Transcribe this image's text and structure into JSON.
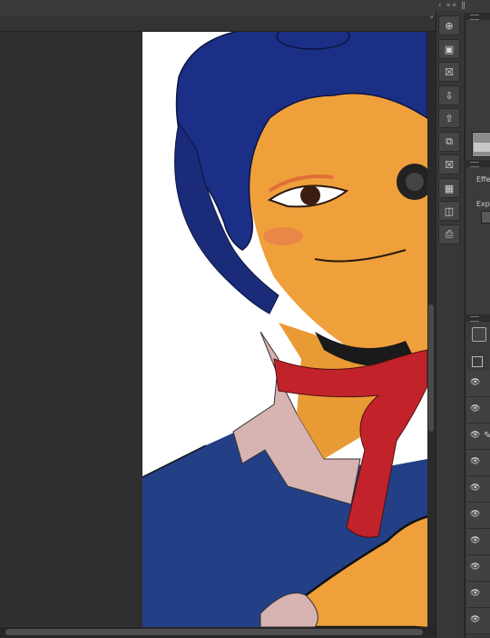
{
  "app": {
    "accent": "#373737",
    "canvas_bg": "#ffffff"
  },
  "tabbar": {
    "chevron": "˅"
  },
  "panel": {
    "arrows": "‹ »« ǁ",
    "effect_label": "Effe",
    "expression_label": "Expr"
  },
  "command_bar": {
    "buttons": [
      {
        "name": "new-icon",
        "glyph": "⊕"
      },
      {
        "name": "open-icon",
        "glyph": "▣"
      },
      {
        "name": "close-icon",
        "glyph": "☒"
      },
      {
        "name": "save-icon",
        "glyph": "⇩"
      },
      {
        "name": "export-icon",
        "glyph": "⇧"
      },
      {
        "name": "copy-icon",
        "glyph": "⧉"
      },
      {
        "name": "delete-icon",
        "glyph": "☒"
      },
      {
        "name": "grid-icon",
        "glyph": "▦"
      },
      {
        "name": "camera-icon",
        "glyph": "◫"
      },
      {
        "name": "print-icon",
        "glyph": "⎙"
      }
    ]
  },
  "layers": {
    "eye_glyph": "👁",
    "pen_glyph": "✎"
  },
  "artwork": {
    "subject": "cartoon character with blue hair, red neckerchief, blue sweater",
    "colors": {
      "hair": "#1c2f86",
      "skin": "#efa03b",
      "scarf": "#c2232a",
      "sweater": "#233f86",
      "collar": "#d7b3b1"
    }
  }
}
